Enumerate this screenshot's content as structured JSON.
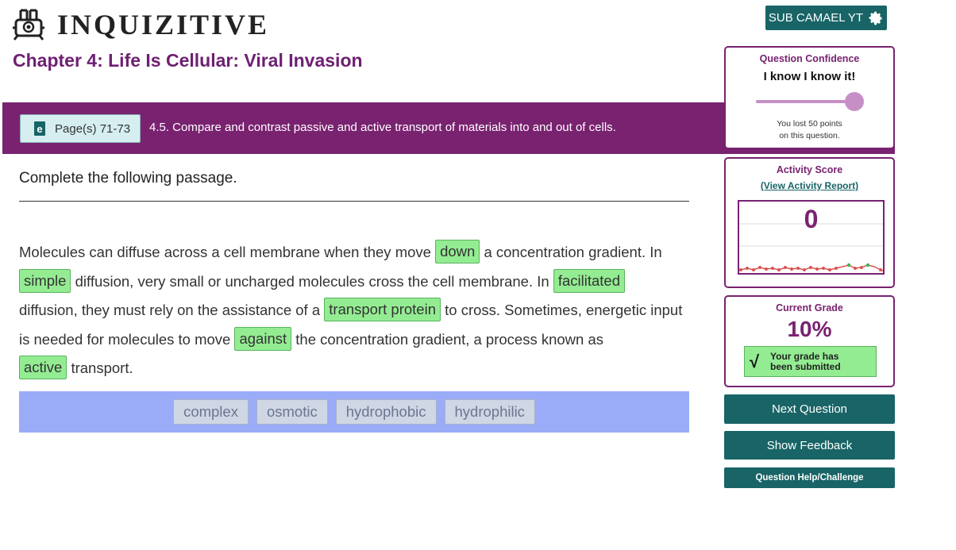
{
  "app": {
    "brand": "INQUIZITIVE"
  },
  "header": {
    "user_label": "SUB CAMAEL YT"
  },
  "chapter": {
    "title": "Chapter 4: Life Is Cellular: Viral Invasion"
  },
  "objective": {
    "page_label": "Page(s) 71-73",
    "text": "4.5. Compare and contrast passive and active transport of materials into and out of cells."
  },
  "question": {
    "prompt": "Complete the following passage.",
    "passage": {
      "s1": "Molecules can diffuse across a cell membrane when they move",
      "b1": "down",
      "s2": "a concentration gradient. In",
      "b2": "simple",
      "s3": "diffusion, very small or uncharged molecules cross the cell membrane. In",
      "b3": "facilitated",
      "s4": "diffusion, they must rely on the assistance of a",
      "b4": "transport protein",
      "s5": "to cross. Sometimes, energetic input is needed for molecules to move",
      "b5": "against",
      "s6": "the concentration gradient, a process known as",
      "b6": "active",
      "s7": "transport."
    },
    "word_bank": [
      "complex",
      "osmotic",
      "hydrophobic",
      "hydrophilic"
    ]
  },
  "confidence": {
    "title": "Question Confidence",
    "value": "I know I know it!",
    "level": 1.0,
    "note_line1": "You lost 50 points",
    "note_line2": "on this question."
  },
  "activity": {
    "title": "Activity Score",
    "report_link": "(View Activity Report)",
    "score": "0"
  },
  "grade": {
    "title": "Current Grade",
    "value": "10%",
    "status_line1": "Your grade has",
    "status_line2": "been submitted"
  },
  "actions": {
    "next": "Next Question",
    "feedback": "Show Feedback",
    "help": "Question Help/Challenge"
  },
  "colors": {
    "brand_purple": "#792270",
    "teal": "#186466",
    "correct_green": "#94ec92",
    "word_bank_bg": "#9aabf8"
  }
}
